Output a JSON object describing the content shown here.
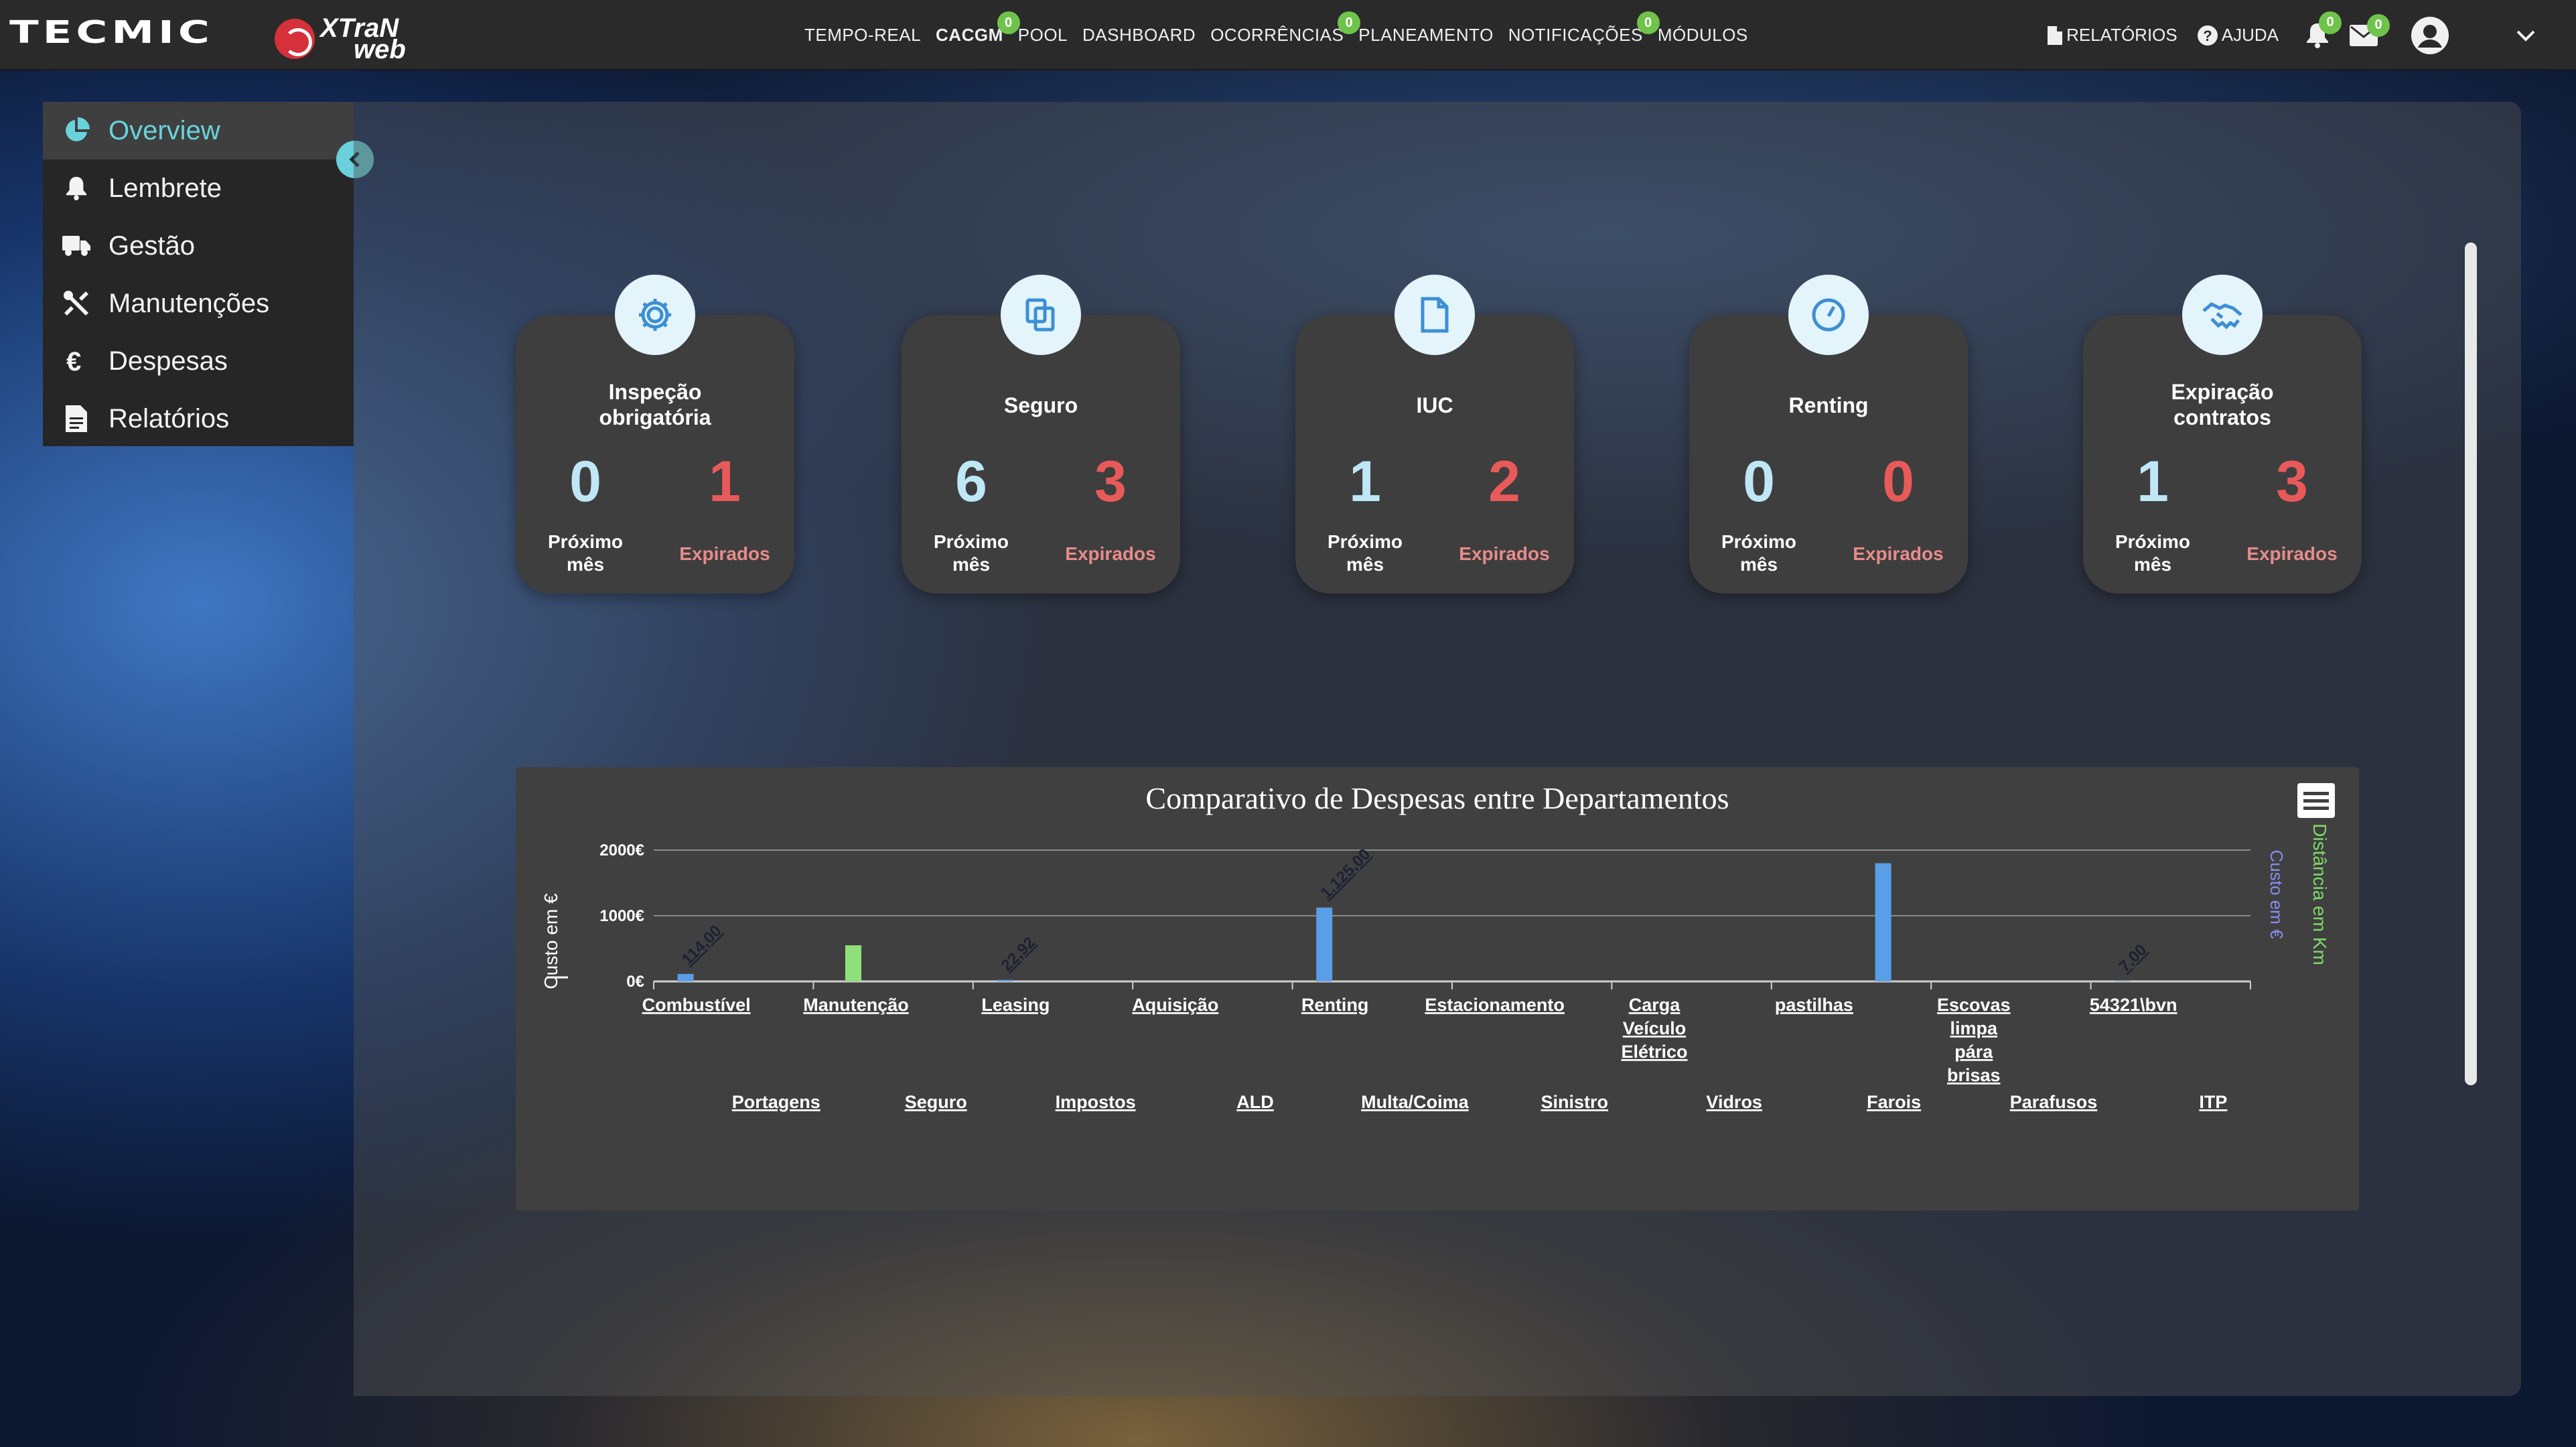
{
  "brand": {
    "logo_text": "TECMIC",
    "product_line1": "XTraN",
    "product_line2": "web"
  },
  "nav": [
    {
      "label": "TEMPO-REAL",
      "badge": null,
      "bold": false
    },
    {
      "label": "CACGM",
      "badge": "0",
      "bold": true
    },
    {
      "label": "POOL",
      "badge": null,
      "bold": false
    },
    {
      "label": "DASHBOARD",
      "badge": null,
      "bold": false
    },
    {
      "label": "OCORRÊNCIAS",
      "badge": "0",
      "bold": false
    },
    {
      "label": "PLANEAMENTO",
      "badge": null,
      "bold": false
    },
    {
      "label": "NOTIFICAÇÕES",
      "badge": "0",
      "bold": false
    },
    {
      "label": "MÓDULOS",
      "badge": null,
      "bold": false
    }
  ],
  "rightnav": {
    "reports": "RELATÓRIOS",
    "help": "AJUDA",
    "bell_badge": "0",
    "mail_badge": "0"
  },
  "sidebar": [
    {
      "label": "Overview",
      "icon": "pie-chart-icon",
      "active": true
    },
    {
      "label": "Lembrete",
      "icon": "bell-icon",
      "active": false
    },
    {
      "label": "Gestão",
      "icon": "truck-icon",
      "active": false
    },
    {
      "label": "Manutenções",
      "icon": "tools-icon",
      "active": false
    },
    {
      "label": "Despesas",
      "icon": "euro-icon",
      "active": false
    },
    {
      "label": "Relatórios",
      "icon": "report-icon",
      "active": false
    }
  ],
  "cards": [
    {
      "title": "Inspeção\nobrigatória",
      "icon": "gear-icon",
      "next": "0",
      "expired": "1"
    },
    {
      "title": "Seguro",
      "icon": "copy-icon",
      "next": "6",
      "expired": "3"
    },
    {
      "title": "IUC",
      "icon": "document-icon",
      "next": "1",
      "expired": "2"
    },
    {
      "title": "Renting",
      "icon": "gauge-icon",
      "next": "0",
      "expired": "0"
    },
    {
      "title": "Expiração\ncontratos",
      "icon": "handshake-icon",
      "next": "1",
      "expired": "3"
    }
  ],
  "card_labels": {
    "next": "Próximo\nmês",
    "expired": "Expirados"
  },
  "colors": {
    "accent": "#69d3dc",
    "badge": "#6fc34a",
    "expired": "#e85a5a",
    "bar_blue": "#5b9ee8",
    "bar_green": "#8fe07a"
  },
  "chart_data": {
    "type": "bar",
    "title": "Comparativo de Despesas entre Departamentos",
    "ylabel": "Custo em €",
    "y2label": "Custo em €",
    "y3label": "Distância em Km",
    "ylim": [
      0,
      2000
    ],
    "yticks": [
      "0€",
      "1000€",
      "2000€"
    ],
    "grid": true,
    "categories_top": [
      "Combustível",
      "Manutenção",
      "Leasing",
      "Aquisição",
      "Renting",
      "Estacionamento",
      "Carga Veículo Elétrico",
      "pastilhas",
      "Escovas limpa pára brisas",
      "54321\\bvn"
    ],
    "categories_bottom": [
      "Portagens",
      "Seguro",
      "Impostos",
      "ALD",
      "Multa/Coima",
      "Sinistro",
      "Vidros",
      "Farois",
      "Parafusos",
      "ITP"
    ],
    "categories": [
      "Combustível",
      "Portagens",
      "Manutenção",
      "Seguro",
      "Leasing",
      "Impostos",
      "Aquisição",
      "ALD",
      "Renting",
      "Multa/Coima",
      "Estacionamento",
      "Sinistro",
      "Carga Veículo Elétrico",
      "Vidros",
      "pastilhas",
      "Farois",
      "Escovas limpa pára brisas",
      "Parafusos",
      "54321\\bvn",
      "ITP"
    ],
    "series": [
      {
        "values": [
          114,
          0,
          0,
          0,
          22.92,
          0,
          0,
          0,
          1125,
          0,
          0,
          0,
          0,
          0,
          0,
          1800,
          0,
          0,
          7,
          0
        ],
        "color": "#5b9ee8"
      },
      {
        "values": [
          0,
          0,
          550,
          0,
          0,
          0,
          0,
          0,
          0,
          0,
          0,
          0,
          0,
          0,
          0,
          0,
          0,
          0,
          0,
          0
        ],
        "color": "#8fe07a"
      }
    ],
    "data_labels": [
      {
        "category": "Combustível",
        "text": "114,00"
      },
      {
        "category": "Leasing",
        "text": "22,92"
      },
      {
        "category": "Renting",
        "text": "1.125,00"
      },
      {
        "category": "54321\\bvn",
        "text": "7,00"
      }
    ]
  }
}
